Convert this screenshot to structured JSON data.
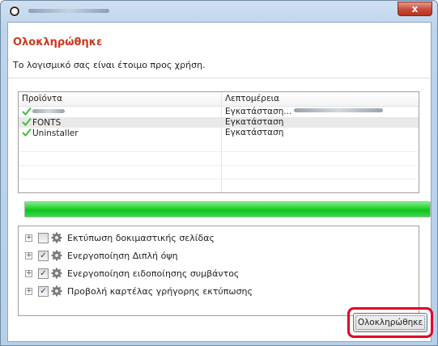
{
  "window": {
    "close_label": "x"
  },
  "header": {
    "title": "Ολοκληρώθηκε",
    "subtitle": "Το λογισμικό σας είναι έτοιμο προς χρήση."
  },
  "table": {
    "columns": [
      "Προϊόντα",
      "Λεπτομέρεια"
    ],
    "rows": [
      {
        "product": "",
        "detail": "Εγκατάσταση..."
      },
      {
        "product": "FONTS",
        "detail": "Εγκατάσταση"
      },
      {
        "product": "Uninstaller",
        "detail": "Εγκατάσταση"
      }
    ]
  },
  "progress": {
    "percent": 100,
    "color": "#1ec92c"
  },
  "options": [
    {
      "label": "Εκτύπωση δοκιμαστικής σελίδας",
      "checked": false,
      "expander": "+"
    },
    {
      "label": "Ενεργοποίηση Διπλή όψη",
      "checked": true,
      "expander": "+"
    },
    {
      "label": "Ενεργοποίηση ειδοποίησης συμβάντος",
      "checked": true,
      "expander": "+"
    },
    {
      "label": "Προβολή καρτέλας γρήγορης εκτύπωσης",
      "checked": true,
      "expander": "+"
    }
  ],
  "footer": {
    "finish_label": "Ολοκληρώθηκε",
    "highlight_color": "#e0002a"
  },
  "colors": {
    "title": "#cc3a1e",
    "check": "#3cc13c"
  }
}
